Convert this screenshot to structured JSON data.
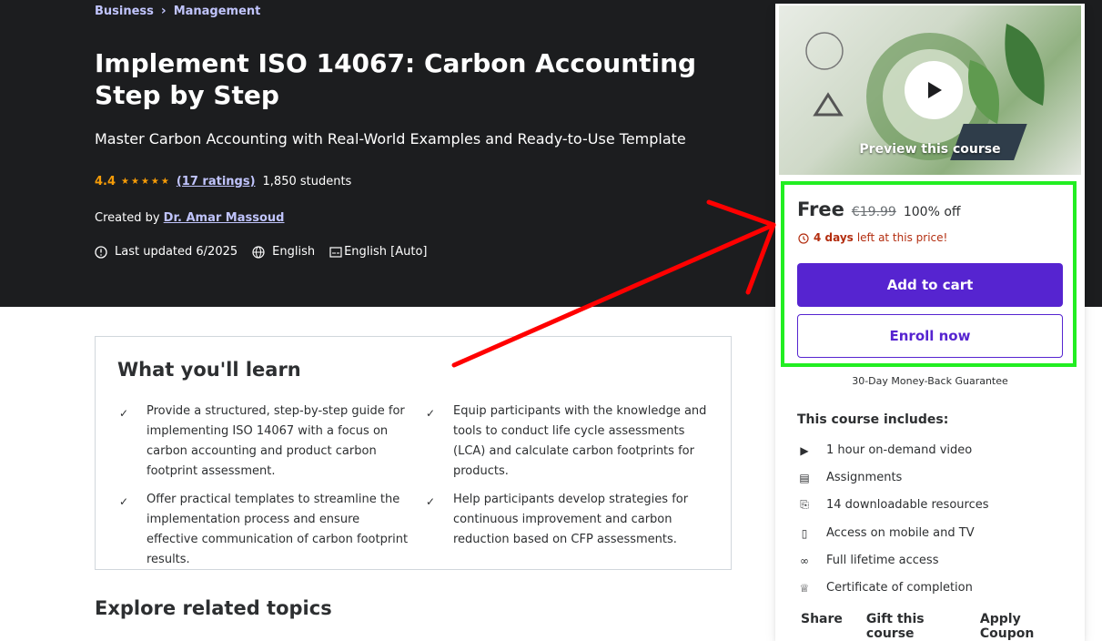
{
  "breadcrumb": {
    "item1": "Business",
    "item2": "Management"
  },
  "course": {
    "title": "Implement ISO 14067: Carbon Accounting Step by Step",
    "subtitle": "Master Carbon Accounting with Real-World Examples and Ready-to-Use Template",
    "rating": "4.4",
    "ratings_count": "(17 ratings)",
    "students": "1,850 students",
    "created_by_label": "Created by",
    "instructor": "Dr. Amar Massoud",
    "last_updated": "Last updated 6/2025",
    "language": "English",
    "captions": "English [Auto]"
  },
  "learn": {
    "title": "What you'll learn",
    "items": [
      "Provide a structured, step-by-step guide for implementing ISO 14067 with a focus on carbon accounting and product carbon footprint assessment.",
      "Equip participants with the knowledge and tools to conduct life cycle assessments (LCA) and calculate carbon footprints for products.",
      "Offer practical templates to streamline the implementation process and ensure effective communication of carbon footprint results.",
      "Help participants develop strategies for continuous improvement and carbon reduction based on CFP assessments."
    ]
  },
  "explore_title": "Explore related topics",
  "sidebar": {
    "preview_label": "Preview this course",
    "price": "Free",
    "original_price": "€19.99",
    "discount": "100% off",
    "timer_bold": "4 days",
    "timer_rest": "left at this price!",
    "add_to_cart": "Add to cart",
    "enroll_now": "Enroll now",
    "guarantee": "30-Day Money-Back Guarantee",
    "includes_title": "This course includes:",
    "includes": [
      {
        "icon": "video-icon",
        "label": "1 hour on-demand video"
      },
      {
        "icon": "assignment-icon",
        "label": "Assignments"
      },
      {
        "icon": "download-icon",
        "label": "14 downloadable resources"
      },
      {
        "icon": "mobile-icon",
        "label": "Access on mobile and TV"
      },
      {
        "icon": "infinity-icon",
        "label": "Full lifetime access"
      },
      {
        "icon": "trophy-icon",
        "label": "Certificate of completion"
      }
    ],
    "share": "Share",
    "gift": "Gift this course",
    "coupon": "Apply Coupon"
  },
  "colors": {
    "hero_bg": "#1c1d1f",
    "accent": "#5624d0",
    "rating": "#f69c08",
    "highlight": "#22ee22",
    "annotation_arrow": "#ff0000"
  }
}
